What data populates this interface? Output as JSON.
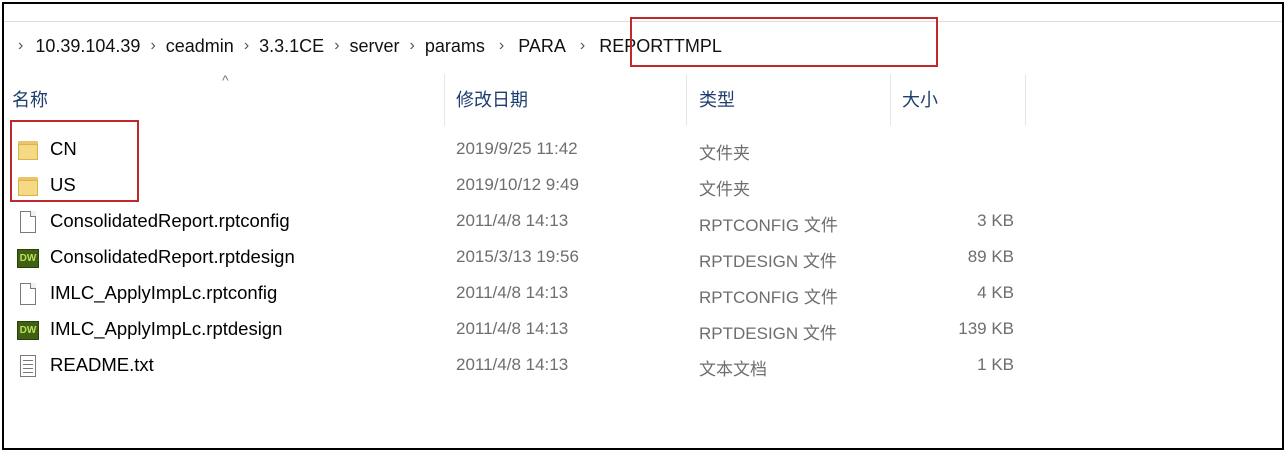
{
  "breadcrumb": {
    "items": [
      "10.39.104.39",
      "ceadmin",
      "3.3.1CE",
      "server",
      "params",
      "PARA",
      "REPORTTMPL"
    ],
    "separator": "›"
  },
  "columns": {
    "name": "名称",
    "date": "修改日期",
    "type": "类型",
    "size": "大小",
    "sort_indicator": "^"
  },
  "files": [
    {
      "name": "CN",
      "date": "2019/9/25 11:42",
      "type": "文件夹",
      "size": "",
      "icon": "folder-icon"
    },
    {
      "name": "US",
      "date": "2019/10/12 9:49",
      "type": "文件夹",
      "size": "",
      "icon": "folder-icon"
    },
    {
      "name": "ConsolidatedReport.rptconfig",
      "date": "2011/4/8 14:13",
      "type": "RPTCONFIG 文件",
      "size": "3 KB",
      "icon": "document-icon"
    },
    {
      "name": "ConsolidatedReport.rptdesign",
      "date": "2015/3/13 19:56",
      "type": "RPTDESIGN 文件",
      "size": "89 KB",
      "icon": "dreamweaver-icon"
    },
    {
      "name": "IMLC_ApplyImpLc.rptconfig",
      "date": "2011/4/8 14:13",
      "type": "RPTCONFIG 文件",
      "size": "4 KB",
      "icon": "document-icon"
    },
    {
      "name": "IMLC_ApplyImpLc.rptdesign",
      "date": "2011/4/8 14:13",
      "type": "RPTDESIGN 文件",
      "size": "139 KB",
      "icon": "dreamweaver-icon"
    },
    {
      "name": "README.txt",
      "date": "2011/4/8 14:13",
      "type": "文本文档",
      "size": "1 KB",
      "icon": "text-document-icon"
    }
  ],
  "dw_icon_label": "DW",
  "colors": {
    "highlight": "#c0282e",
    "header_text": "#1e3e6e",
    "meta_text": "#6e6e6e"
  }
}
